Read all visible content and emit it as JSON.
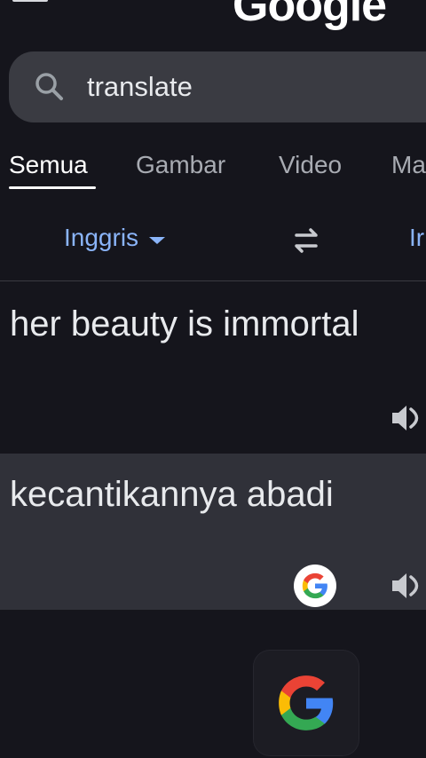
{
  "header": {
    "menu_icon": "hamburger-menu-icon",
    "logo_text": "Google"
  },
  "search": {
    "query": "translate",
    "icon": "search-icon"
  },
  "tabs": [
    {
      "label": "Semua",
      "active": true
    },
    {
      "label": "Gambar",
      "active": false
    },
    {
      "label": "Video",
      "active": false
    },
    {
      "label": "Ma",
      "active": false
    }
  ],
  "translator": {
    "source_language": "Inggris",
    "target_language": "Ir",
    "source_text": "her beauty is immortal",
    "translated_text": "kecantikannya abadi",
    "swap_icon": "swap-arrows-icon",
    "speaker_icon": "speaker-icon"
  },
  "colors": {
    "background": "#15151c",
    "search_bar": "#3a3b42",
    "result_panel": "#303139",
    "link_blue": "#8ab4f8",
    "tab_inactive": "#a8abb2"
  }
}
